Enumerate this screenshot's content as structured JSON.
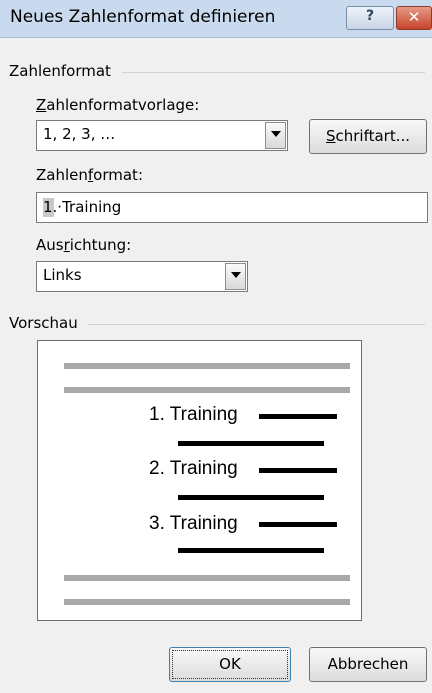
{
  "dialog": {
    "title": "Neues Zahlenformat definieren",
    "help_glyph": "?",
    "close_glyph": "✕"
  },
  "number_format_group": {
    "label": "Zahlenformat",
    "template_label_access": "Z",
    "template_label_rest": "ahlenformatvorlage:",
    "template_value": "1, 2, 3, …",
    "font_button": {
      "access": "S",
      "rest": "chriftart..."
    },
    "format_label_pre": "Zahlen",
    "format_label_access": "f",
    "format_label_post": "ormat:",
    "format_value": "1.·Training",
    "alignment_label_pre": "Aus",
    "alignment_label_access": "r",
    "alignment_label_post": "ichtung:",
    "alignment_value": "Links"
  },
  "preview_group": {
    "label": "Vorschau",
    "items": [
      "1. Training",
      "2. Training",
      "3. Training"
    ]
  },
  "buttons": {
    "ok": "OK",
    "cancel": "Abbrechen"
  }
}
